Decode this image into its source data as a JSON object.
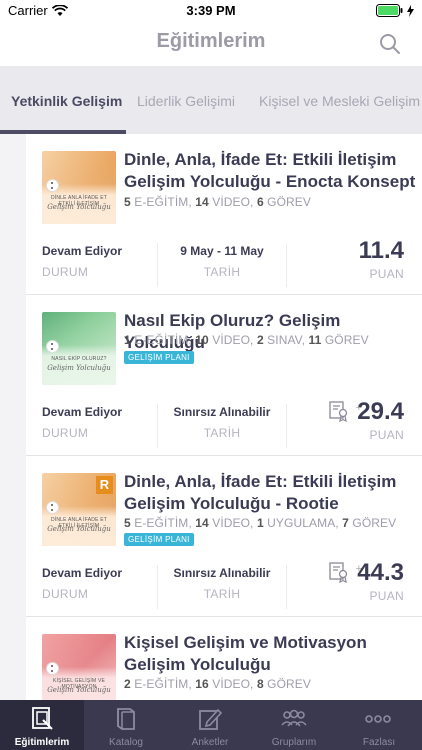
{
  "status": {
    "carrier": "Carrier",
    "time": "3:39 PM"
  },
  "nav": {
    "title": "Eğitimlerim"
  },
  "tabs": [
    {
      "label": "Yetkinlik Gelişim",
      "active": true
    },
    {
      "label": "Liderlik Gelişimi",
      "active": false
    },
    {
      "label": "Kişisel ve Mesleki Gelişim",
      "active": false
    }
  ],
  "cards": [
    {
      "title": "Dinle, Anla, İfade Et: Etkili İletişim Gelişim Yolculuğu - Enocta Konsept",
      "meta": {
        "c1": "5",
        "l1": " E-EĞİTİM, ",
        "c2": "14",
        "l2": " VİDEO, ",
        "c3": "6",
        "l3": " GÖREV",
        "c4": "",
        "l4": ""
      },
      "badge": "",
      "thumb": {
        "t1": "DİNLE ANLA İFADE ET ETKİLİ İLETİŞİM",
        "t2": "Gelişim Yolculuğu"
      },
      "status_value": "Devam Ediyor",
      "status_label": "DURUM",
      "date_value": "9 May - 11 May",
      "date_label": "TARİH",
      "points": "11.4",
      "points_label": "PUAN"
    },
    {
      "title": "Nasıl Ekip Oluruz? Gelişim Yolculuğu",
      "meta": {
        "c1": "1",
        "l1": " E-EĞİTİM, ",
        "c2": "10",
        "l2": " VİDEO, ",
        "c3": "2",
        "l3": " SINAV, ",
        "c4": "11",
        "l4": " GÖREV"
      },
      "badge": "GELİŞİM PLANI",
      "thumb": {
        "t1": "NASIL EKİP OLURUZ?",
        "t2": "Gelişim Yolculuğu"
      },
      "status_value": "Devam Ediyor",
      "status_label": "DURUM",
      "date_value": "Sınırsız Alınabilir",
      "date_label": "TARİH",
      "points": "29.4",
      "points_label": "PUAN"
    },
    {
      "title": "Dinle, Anla, İfade Et: Etkili İletişim Gelişim Yolculuğu - Rootie",
      "meta": {
        "c1": "5",
        "l1": " E-EĞİTİM, ",
        "c2": "14",
        "l2": " VİDEO, ",
        "c3": "1",
        "l3": " UYGULAMA, ",
        "c4": "7",
        "l4": " GÖREV"
      },
      "badge": "GELİŞİM PLANI",
      "thumb": {
        "t1": "DİNLE ANLA İFADE ET ETKİLİ İLETİŞİM",
        "t2": "Gelişim Yolculuğu",
        "badge": "R"
      },
      "status_value": "Devam Ediyor",
      "status_label": "DURUM",
      "date_value": "Sınırsız Alınabilir",
      "date_label": "TARİH",
      "points": "44.3",
      "points_label": "PUAN"
    },
    {
      "title": "Kişisel Gelişim ve Motivasyon Gelişim Yolculuğu",
      "meta": {
        "c1": "2",
        "l1": " E-EĞİTİM, ",
        "c2": "16",
        "l2": " VİDEO, ",
        "c3": "8",
        "l3": " GÖREV",
        "c4": "",
        "l4": ""
      },
      "badge": "",
      "thumb": {
        "t1": "KİŞİSEL GELİŞİM VE MOTİVASYON",
        "t2": "Gelişim Yolculuğu"
      }
    }
  ],
  "tabbar": [
    {
      "label": "Eğitimlerim",
      "icon": "courses-icon",
      "active": true
    },
    {
      "label": "Katalog",
      "icon": "catalog-book-icon",
      "active": false
    },
    {
      "label": "Anketler",
      "icon": "survey-edit-icon",
      "active": false
    },
    {
      "label": "Gruplarım",
      "icon": "groups-icon",
      "active": false
    },
    {
      "label": "Fazlası",
      "icon": "more-dots-icon",
      "active": false
    }
  ],
  "colors": {
    "accent": "#3a394f",
    "badge": "#39b5d8",
    "title": "#3c3b55",
    "muted": "#b5b4c0"
  }
}
